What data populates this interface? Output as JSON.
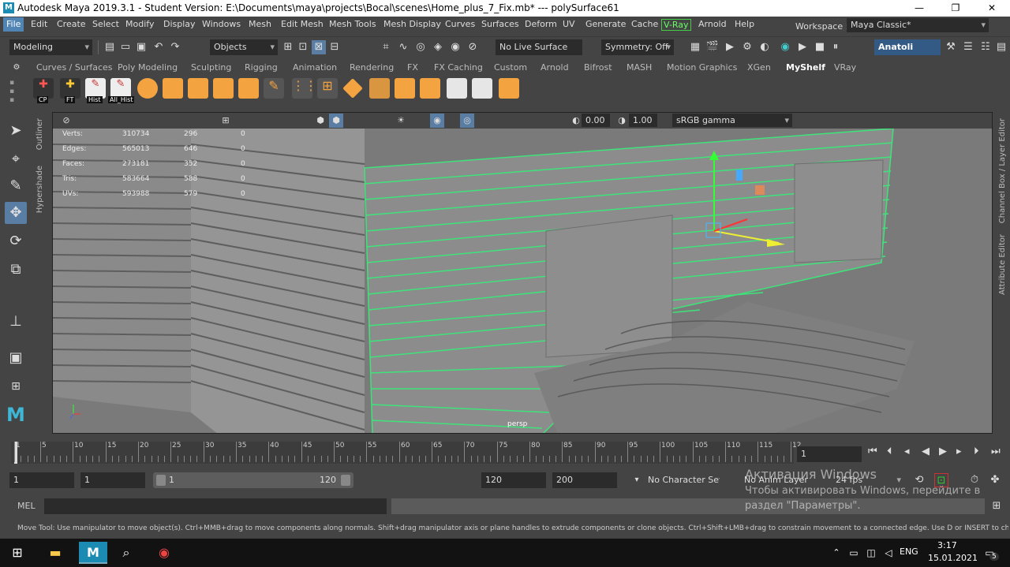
{
  "title": {
    "text": "Autodesk Maya 2019.3.1 - Student Version: E:\\Documents\\maya\\projects\\Bocal\\scenes\\Home_plus_7_Fix.mb*   ---   polySurface61",
    "logo": "M"
  },
  "window_controls": {
    "minimize": "—",
    "maximize": "❐",
    "close": "✕"
  },
  "menu": [
    "File",
    "Edit",
    "Create",
    "Select",
    "Modify",
    "Display",
    "Windows",
    "Mesh",
    "Edit Mesh",
    "Mesh Tools",
    "Mesh Display",
    "Curves",
    "Surfaces",
    "Deform",
    "UV",
    "Generate",
    "Cache",
    "V-Ray",
    "Arnold",
    "Help"
  ],
  "workspace": {
    "label": "Workspace :",
    "value": "Maya Classic*"
  },
  "status": {
    "mode": "Modeling",
    "objects": "Objects",
    "live_surface": "No Live Surface",
    "symmetry": "Symmetry: Off",
    "user": "Anatoli"
  },
  "shelf_tabs": [
    "Curves / Surfaces",
    "Poly Modeling",
    "Sculpting",
    "Rigging",
    "Animation",
    "Rendering",
    "FX",
    "FX Caching",
    "Custom",
    "Arnold",
    "Bifrost",
    "MASH",
    "Motion Graphics",
    "XGen",
    "MyShelf",
    "VRay"
  ],
  "shelf_active": "MyShelf",
  "shelf_labels": [
    "CP",
    "FT",
    "Hist",
    "All_Hist"
  ],
  "side_panels": {
    "outliner": "Outliner",
    "hypershade": "Hypershade",
    "channel_box": "Channel Box / Layer Editor",
    "attribute_editor": "Attribute Editor"
  },
  "viewport": {
    "exposure": "0.00",
    "gamma": "1.00",
    "color_space": "sRGB gamma",
    "camera": "persp",
    "hud": [
      {
        "label": "Verts:",
        "a": "310734",
        "b": "296",
        "c": "0"
      },
      {
        "label": "Edges:",
        "a": "565013",
        "b": "646",
        "c": "0"
      },
      {
        "label": "Faces:",
        "a": "273181",
        "b": "352",
        "c": "0"
      },
      {
        "label": "Tris:",
        "a": "583664",
        "b": "588",
        "c": "0"
      },
      {
        "label": "UVs:",
        "a": "593988",
        "b": "579",
        "c": "0"
      }
    ]
  },
  "timeline": {
    "ticks": [
      "1",
      "5",
      "10",
      "15",
      "20",
      "25",
      "30",
      "35",
      "40",
      "45",
      "50",
      "55",
      "60",
      "65",
      "70",
      "75",
      "80",
      "85",
      "90",
      "95",
      "100",
      "105",
      "110",
      "115",
      "12"
    ],
    "current": "1"
  },
  "range": {
    "start": "1",
    "inner_start": "1",
    "slider_start": "1",
    "slider_end": "120",
    "end": "120",
    "outer_end": "200",
    "character_set": "No Character Set",
    "anim_layer": "No Anim Layer",
    "fps": "24 fps"
  },
  "mel": {
    "label": "MEL"
  },
  "help_line": "Move Tool: Use manipulator to move object(s). Ctrl+MMB+drag to move components along normals. Shift+drag manipulator axis or plane handles to extrude components or clone objects. Ctrl+Shift+LMB+drag to constrain movement to a connected edge. Use D or INSERT to change the pivot position a",
  "activation": {
    "title": "Активация Windows",
    "line1": "Чтобы активировать Windows, перейдите в",
    "line2": "раздел \"Параметры\"."
  },
  "taskbar": {
    "lang": "ENG",
    "time": "3:17",
    "date": "15.01.2021",
    "notifications": "5"
  },
  "colors": {
    "accent": "#4f84b5",
    "selection": "#3ee37a",
    "maya": "#1b8bb3"
  }
}
